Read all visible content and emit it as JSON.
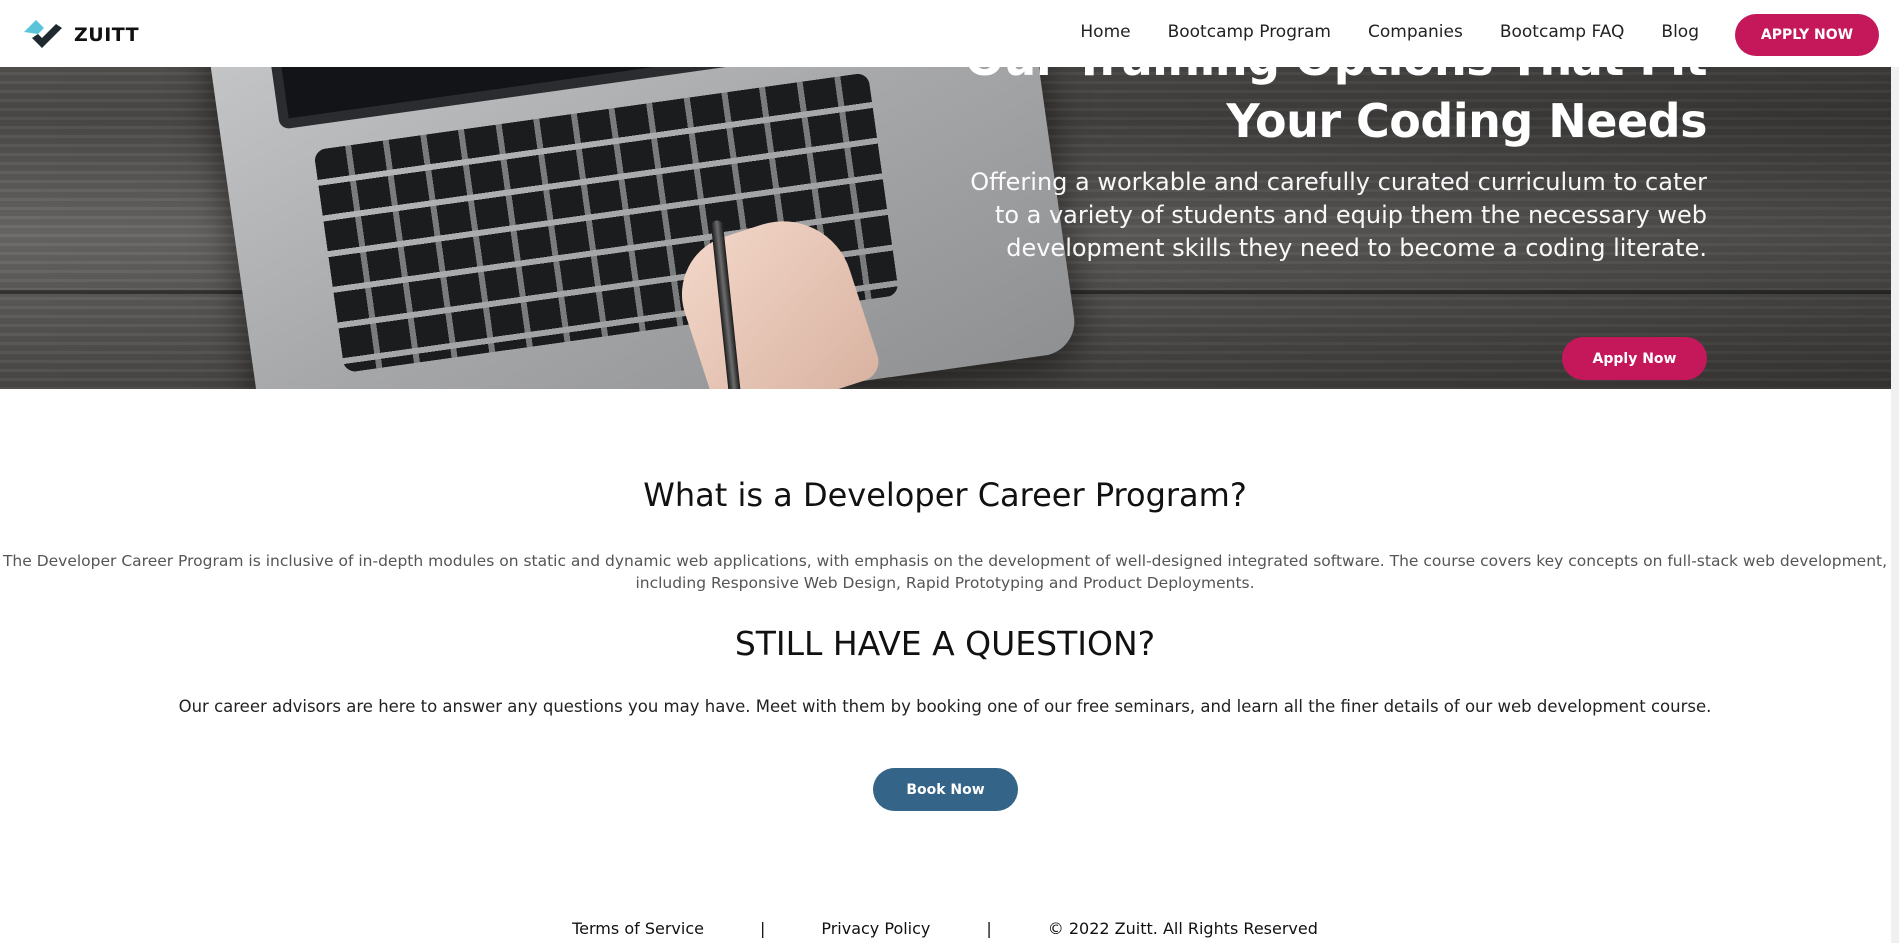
{
  "brand": {
    "name": "ZUITT",
    "colors": {
      "primary": "#c4185a",
      "secondary": "#346487",
      "logo_accent": "#5bc4d8",
      "logo_dark": "#1f2a30"
    }
  },
  "nav": {
    "links": [
      "Home",
      "Bootcamp Program",
      "Companies",
      "Bootcamp FAQ",
      "Blog"
    ],
    "apply_label": "APPLY NOW"
  },
  "hero": {
    "title_line1": "Our Training Options That Fit",
    "title_line2": "Your Coding Needs",
    "subtitle": "Offering a workable and carefully curated curriculum to cater to a variety of students and equip them the necessary web development skills they need to become a coding literate.",
    "apply_label": "Apply Now"
  },
  "program": {
    "title": "What is a Developer Career Program?",
    "description": "The Developer Career Program is inclusive of in-depth modules on static and dynamic web applications, with emphasis on the development of well-designed integrated software. The course covers key concepts on full-stack web development, including Responsive Web Design, Rapid Prototyping and Product Deployments."
  },
  "question": {
    "title": "STILL HAVE A QUESTION?",
    "description": "Our career advisors are here to answer any questions you may have. Meet with them by booking one of our free seminars, and learn all the finer details of our web development course.",
    "book_label": "Book Now"
  },
  "footer": {
    "terms": "Terms of Service",
    "separator": "|",
    "privacy": "Privacy Policy",
    "copyright": "© 2022 Zuitt. All Rights Reserved"
  }
}
